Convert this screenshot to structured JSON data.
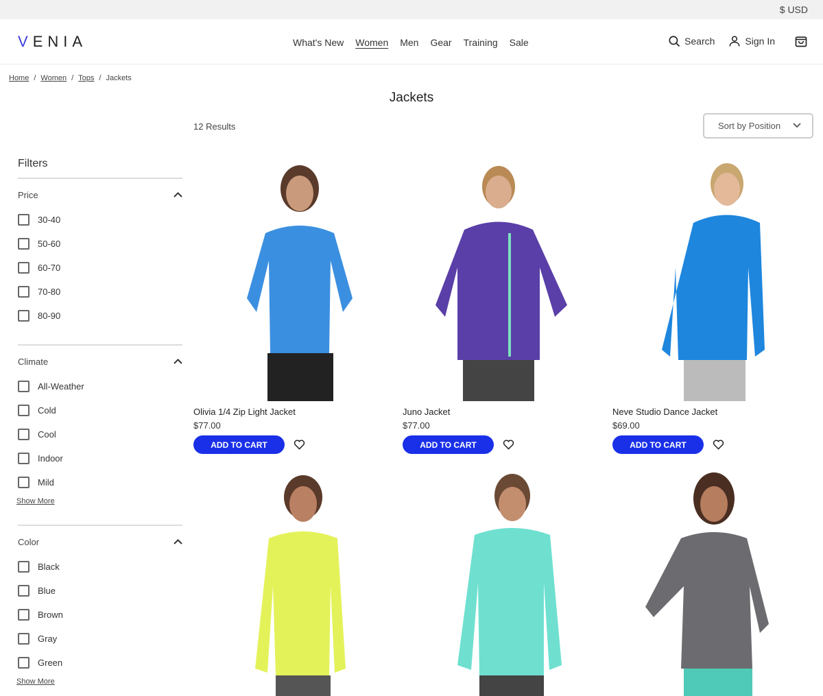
{
  "topbar": {
    "currency": "$ USD"
  },
  "header": {
    "logo": "VENIA",
    "nav": [
      "What's New",
      "Women",
      "Men",
      "Gear",
      "Training",
      "Sale"
    ],
    "active_nav": "Women",
    "search_label": "Search",
    "signin_label": "Sign In",
    "cart_icon": "shopping-bag-icon"
  },
  "breadcrumb": [
    "Home",
    "Women",
    "Tops",
    "Jackets"
  ],
  "page": {
    "title": "Jackets",
    "results": "12 Results",
    "sort_label": "Sort by Position"
  },
  "filters": {
    "title": "Filters",
    "groups": [
      {
        "name": "Price",
        "options": [
          "30-40",
          "50-60",
          "60-70",
          "70-80",
          "80-90"
        ],
        "show_more": ""
      },
      {
        "name": "Climate",
        "options": [
          "All-Weather",
          "Cold",
          "Cool",
          "Indoor",
          "Mild"
        ],
        "show_more": "Show More"
      },
      {
        "name": "Color",
        "options": [
          "Black",
          "Blue",
          "Brown",
          "Gray",
          "Green"
        ],
        "show_more": "Show More"
      }
    ]
  },
  "products": [
    {
      "name": "Olivia 1/4 Zip Light Jacket",
      "price": "$77.00",
      "button": "ADD TO CART",
      "color": "#3b8fe0"
    },
    {
      "name": "Juno Jacket",
      "price": "$77.00",
      "button": "ADD TO CART",
      "color": "#5a3fa8"
    },
    {
      "name": "Neve Studio Dance Jacket",
      "price": "$69.00",
      "button": "ADD TO CART",
      "color": "#1e86dd"
    }
  ],
  "products_row2": [
    {
      "color": "#e4f25a"
    },
    {
      "color": "#6fe0d0"
    },
    {
      "color": "#6c6c70"
    }
  ],
  "colors": {
    "accent": "#1a30e8",
    "logo_v": "#3b3fd8"
  }
}
